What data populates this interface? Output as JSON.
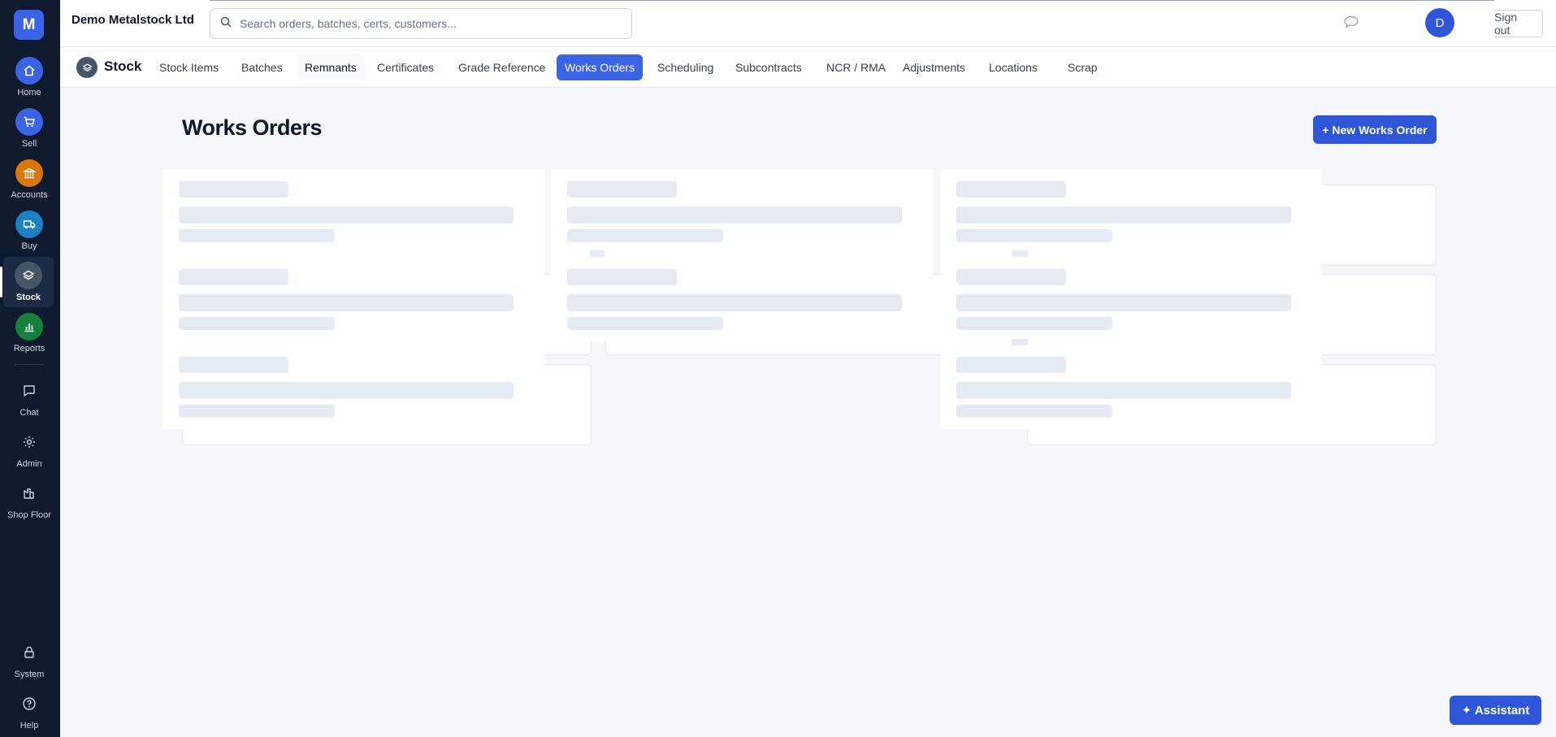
{
  "app": {
    "logo_letter": "M",
    "company": "Demo Metalstock Ltd"
  },
  "search": {
    "placeholder": "Search orders, batches, certs, customers..."
  },
  "header": {
    "avatar_letter": "D",
    "signout_label": "Sign out"
  },
  "sidebar": {
    "items": [
      {
        "label": "Home",
        "icon": "home-icon",
        "color": "#3b63e6"
      },
      {
        "label": "Sell",
        "icon": "cart-icon",
        "color": "#3b63e6"
      },
      {
        "label": "Accounts",
        "icon": "bank-icon",
        "color": "#d97706"
      },
      {
        "label": "Buy",
        "icon": "truck-icon",
        "color": "#1d7fc4"
      },
      {
        "label": "Stock",
        "icon": "layers-icon",
        "color": "#475569"
      },
      {
        "label": "Reports",
        "icon": "bar-chart-icon",
        "color": "#15803d"
      },
      {
        "label": "Chat",
        "icon": "chat-icon"
      },
      {
        "label": "Admin",
        "icon": "gear-icon"
      },
      {
        "label": "Shop Floor",
        "icon": "factory-icon"
      },
      {
        "label": "System",
        "icon": "lock-icon"
      },
      {
        "label": "Help",
        "icon": "help-icon"
      }
    ]
  },
  "module": {
    "title": "Stock"
  },
  "tabs": [
    "Stock Items",
    "Batches",
    "Remnants",
    "Certificates",
    "Grade Reference",
    "Works Orders",
    "Scheduling",
    "Subcontracts",
    "NCR / RMA",
    "Adjustments",
    "Locations",
    "Scrap"
  ],
  "active_tab": "Works Orders",
  "main": {
    "title": "Works Orders",
    "new_button": "+ New Works Order"
  },
  "assistant_label": "✦ Assistant",
  "colors": {
    "accent": "#3b63e6",
    "sidebar": "#0f1a2e",
    "skeleton": "#e6eaf2"
  }
}
